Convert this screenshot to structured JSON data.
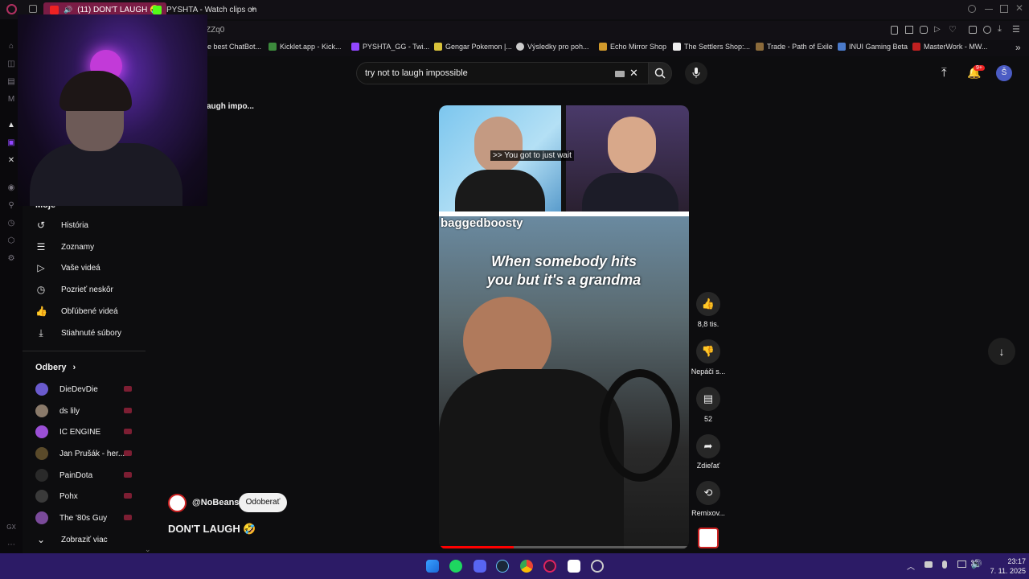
{
  "browser": {
    "tabs": [
      {
        "label": "(11) DON'T LAUGH 🤣",
        "active": true
      },
      {
        "label": "PYSHTA - Watch clips on",
        "active": false
      }
    ],
    "new_tab_symbol": "+",
    "url_fragment": "ZZq0",
    "bookmarks": [
      "e best ChatBot...",
      "Kicklet.app - Kick...",
      "PYSHTA_GG - Twi...",
      "Gengar Pokemon |...",
      "Výsledky pro poh...",
      "Echo Mirror Shop",
      "The Settlers Shop:...",
      "Trade - Path of Exile",
      "INUI Gaming Beta",
      "MasterWork - MW..."
    ],
    "bookmarks_more": "»"
  },
  "youtube": {
    "playlist_partial": "augh impo...",
    "sidebar": {
      "you_heading_partial": "Moje",
      "you_items": [
        {
          "icon": "history-icon",
          "label": "História"
        },
        {
          "icon": "playlists-icon",
          "label": "Zoznamy"
        },
        {
          "icon": "your-videos-icon",
          "label": "Vaše videá"
        },
        {
          "icon": "watch-later-icon",
          "label": "Pozrieť neskôr"
        },
        {
          "icon": "liked-icon",
          "label": "Obľúbené videá"
        },
        {
          "icon": "download-icon",
          "label": "Stiahnuté súbory"
        }
      ],
      "subscriptions_heading": "Odbery",
      "subscriptions": [
        {
          "name": "DieDevDie",
          "color": "#6a5acd"
        },
        {
          "name": "ds lily",
          "color": "#8a7a6a"
        },
        {
          "name": "IC ENGINE",
          "color": "#9b4fd6"
        },
        {
          "name": "Jan Prušák - her...",
          "color": "#5a4a2a"
        },
        {
          "name": "PainDota",
          "color": "#2a2a2a"
        },
        {
          "name": "Pohx",
          "color": "#3a3a3a"
        },
        {
          "name": "The '80s Guy",
          "color": "#7a4a9a"
        }
      ],
      "show_more": "Zobraziť viac"
    },
    "search": {
      "query": "try not to laugh impossible",
      "clear_symbol": "✕"
    },
    "header_right": {
      "notifications_badge": "9+",
      "avatar_letter": "Š",
      "avatar_color": "#4b5cc4"
    },
    "short": {
      "caption": ">> You got to just wait",
      "watermark": "baggedboosty",
      "overlay_text_line1": "When somebody hits",
      "overlay_text_line2": "you but it's a grandma",
      "channel": "@NoBeans",
      "subscribe": "Odoberať",
      "title": "DON'T LAUGH 🤣",
      "likes": "8,8 tis.",
      "dislike": "Nepáči s...",
      "comments": "52",
      "share": "Zdieľať",
      "remix": "Remixov..."
    }
  },
  "taskbar": {
    "time": "23:17",
    "date": "7. 11. 2025",
    "accent": "#2c1b66"
  }
}
